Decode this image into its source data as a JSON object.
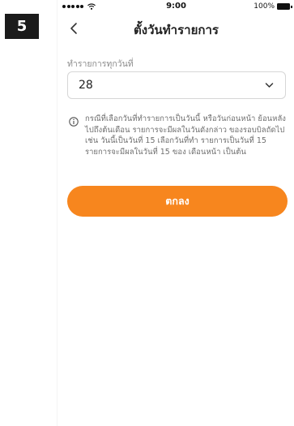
{
  "step": {
    "number": "5"
  },
  "status_bar": {
    "time": "9:00",
    "battery_percent": "100%",
    "icons": [
      "signal-dots-icon",
      "wifi-icon",
      "battery-icon"
    ]
  },
  "header": {
    "title": "ตั้งวันทำรายการ",
    "back_icon": "chevron-left-icon"
  },
  "form": {
    "day_label": "ทำรายการทุกวันที่",
    "day_value": "28",
    "day_dropdown_icon": "chevron-down-icon"
  },
  "notice": {
    "icon": "info-icon",
    "text": "กรณีที่เลือกวันที่ทำรายการเป็นวันนี้ หรือวันก่อนหน้า ย้อนหลังไปถึงต้นเดือน รายการจะมีผลในวันดังกล่าว ของรอบบิลถัดไป เช่น วันนี้เป็นวันที่ 15 เลือกวันที่ทำ รายการเป็นวันที่ 15 รายการจะมีผลในวันที่ 15 ของ เดือนหน้า เป็นต้น"
  },
  "actions": {
    "confirm_label": "ตกลง"
  },
  "colors": {
    "accent": "#f7861e",
    "badge_bg": "#1b1b1b",
    "text_primary": "#222222",
    "text_secondary": "#6f6f6f"
  }
}
